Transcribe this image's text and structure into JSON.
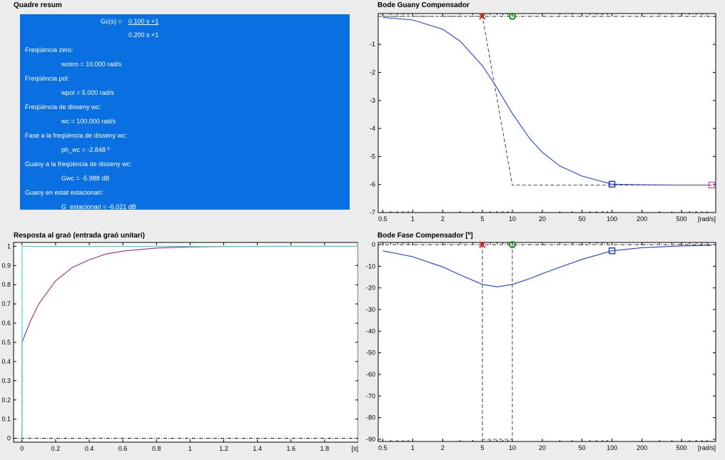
{
  "summary": {
    "title": "Quadre resum",
    "tf_label": "Gc(s) =",
    "tf_num": "0.100 s +1",
    "tf_den": "0.200 s +1",
    "lines": [
      "Freqüència zero:",
      "wzero = 10.000 rad/s",
      "Freqüència pol:",
      "wpol = 5.000 rad/s",
      "Freqüència de disseny wc:",
      "wc = 100.000 rad/s",
      "Fase a la freqüència de disseny wc:",
      "ph_wc = -2.848 º",
      "Guany a la freqüència de disseny wc:",
      "Gwc = -5.988 dB",
      "Guany en estat estacionari:",
      "G_estacionari = -6.021 dB"
    ]
  },
  "colors": {
    "summary_bg": "#0a6fe0",
    "response": "#9b2a8f",
    "step_input": "#3fd8d0",
    "bode": "#1f3fe0",
    "pole": "#e02020",
    "zero": "#1a8a1a",
    "wc_marker": "#1f3fe0",
    "hf_marker": "#e040c0"
  },
  "chart_data": [
    {
      "id": "gain",
      "type": "line",
      "title": "Bode Guany Compensador",
      "xscale": "log",
      "xlim": [
        0.45,
        1100
      ],
      "ylim": [
        -7,
        0.1
      ],
      "xticks": [
        0.5,
        1,
        2,
        5,
        10,
        20,
        50,
        100,
        200,
        500
      ],
      "xtick_labels": [
        "0.5",
        "1",
        "2",
        "5",
        "10",
        "20",
        "50",
        "100",
        "200",
        "500"
      ],
      "yticks": [
        0,
        -1,
        -2,
        -3,
        -4,
        -5,
        -6,
        -7
      ],
      "ytick_labels": [
        "",
        "-1",
        "-2",
        "-3",
        "-4",
        "-5",
        "-6",
        "-7"
      ],
      "xunit": "[rad/s]",
      "zero_freq": 10,
      "pole_freq": 5,
      "wc": 100,
      "series": [
        {
          "kind": "exact",
          "x": [
            0.5,
            1,
            2,
            3,
            5,
            7,
            10,
            15,
            20,
            30,
            50,
            100,
            200,
            500,
            1000
          ],
          "y": [
            -0.04,
            -0.13,
            -0.46,
            -0.89,
            -1.76,
            -2.55,
            -3.47,
            -4.37,
            -4.85,
            -5.34,
            -5.7,
            -5.99,
            -6.01,
            -6.02,
            -6.02
          ]
        },
        {
          "kind": "asymptote",
          "x": [
            0.45,
            5,
            10,
            1000
          ],
          "y": [
            0,
            0,
            -6.02,
            -6.02
          ]
        }
      ],
      "markers": [
        {
          "kind": "pole",
          "x": 5,
          "y": 0
        },
        {
          "kind": "zero",
          "x": 10,
          "y": 0
        },
        {
          "kind": "wc",
          "x": 100,
          "y": -5.99
        },
        {
          "kind": "hf",
          "x": 1000,
          "y": -6.02
        }
      ]
    },
    {
      "id": "phase",
      "type": "line",
      "title": "Bode Fase Compensador [º]",
      "xscale": "log",
      "xlim": [
        0.45,
        1100
      ],
      "ylim": [
        -91,
        1
      ],
      "xticks": [
        0.5,
        1,
        2,
        5,
        10,
        20,
        50,
        100,
        200,
        500
      ],
      "xtick_labels": [
        "0.5",
        "1",
        "2",
        "5",
        "10",
        "20",
        "50",
        "100",
        "200",
        "500"
      ],
      "yticks": [
        0,
        -10,
        -20,
        -30,
        -40,
        -50,
        -60,
        -70,
        -80,
        -90
      ],
      "ytick_labels": [
        "0",
        "-10",
        "-20",
        "-30",
        "-40",
        "-50",
        "-60",
        "-70",
        "-80",
        "-90"
      ],
      "xunit": "[rad/s]",
      "series": [
        {
          "kind": "exact",
          "x": [
            0.5,
            1,
            2,
            3,
            5,
            7.07,
            10,
            15,
            20,
            30,
            50,
            100,
            200,
            500,
            1000
          ],
          "y": [
            -2.85,
            -5.6,
            -10.3,
            -14.0,
            -18.4,
            -19.5,
            -18.4,
            -15.7,
            -13.4,
            -10.4,
            -6.8,
            -2.85,
            -1.4,
            -0.57,
            -0.29
          ]
        },
        {
          "kind": "asymptote",
          "x": [
            5,
            5,
            10,
            10
          ],
          "y": [
            0,
            -90,
            -90,
            0
          ]
        }
      ],
      "markers": [
        {
          "kind": "pole",
          "x": 5,
          "y": 0
        },
        {
          "kind": "zero",
          "x": 10,
          "y": 0
        },
        {
          "kind": "wc",
          "x": 100,
          "y": -2.85
        }
      ]
    },
    {
      "id": "step",
      "type": "line",
      "title": "Resposta al graó (entrada graó unitari)",
      "xlim": [
        -0.05,
        2.0
      ],
      "ylim": [
        -0.02,
        1.02
      ],
      "xticks": [
        0,
        0.2,
        0.4,
        0.6,
        0.8,
        1,
        1.2,
        1.4,
        1.6,
        1.8
      ],
      "xtick_labels": [
        "0",
        "0.2",
        "0.4",
        "0.6",
        "0.8",
        "1",
        "1.2",
        "1.4",
        "1.6",
        "1.8"
      ],
      "yticks": [
        0,
        0.1,
        0.2,
        0.3,
        0.4,
        0.5,
        0.6,
        0.7,
        0.8,
        0.9,
        1
      ],
      "ytick_labels": [
        "0",
        "0.1",
        "0.2",
        "0.3",
        "0.4",
        "0.5",
        "0.6",
        "0.7",
        "0.8",
        "0.9",
        "1"
      ],
      "xunit": "[s]",
      "series": [
        {
          "kind": "response",
          "x": [
            0,
            0,
            0.05,
            0.1,
            0.2,
            0.3,
            0.4,
            0.5,
            0.6,
            0.8,
            1.0,
            1.2,
            1.5,
            2.0
          ],
          "y": [
            0,
            0.5,
            0.61,
            0.7,
            0.82,
            0.89,
            0.93,
            0.96,
            0.975,
            0.991,
            0.997,
            0.999,
            1.0,
            1.0
          ]
        },
        {
          "kind": "input",
          "x": [
            0,
            0,
            2.0
          ],
          "y": [
            0,
            1,
            1
          ]
        }
      ]
    }
  ]
}
